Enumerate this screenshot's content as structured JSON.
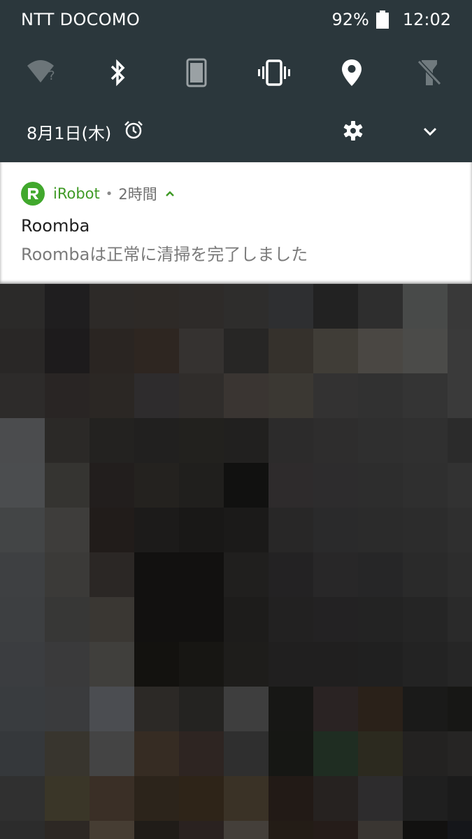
{
  "status_bar": {
    "carrier": "NTT DOCOMO",
    "battery": "92%",
    "time": "12:02"
  },
  "quick_settings": {
    "tiles": [
      "wifi-unknown",
      "bluetooth",
      "screen-rotation",
      "vibrate",
      "location",
      "flashlight-off"
    ],
    "date": "8月1日(木)"
  },
  "notification": {
    "app_name": "iRobot",
    "separator": "•",
    "time_ago": "2時間",
    "title": "Roomba",
    "body": "Roombaは正常に清掃を完了しました",
    "accent_color": "#3f9a26"
  },
  "colors": {
    "panel_bg": "#2b373c",
    "card_bg": "#ffffff"
  },
  "wallpaper_colors": [
    [
      "#2b2a29",
      "#1f1e1f",
      "#2d2a28",
      "#2e2a27",
      "#2e2b29",
      "#2e2d2c",
      "#2e2f31",
      "#222222",
      "#2e2e2e",
      "#484a49",
      "#393939"
    ],
    [
      "#292726",
      "#1d1b1c",
      "#2a2522",
      "#2e2621",
      "#353230",
      "#272625",
      "#35312c",
      "#403d37",
      "#4a4743",
      "#4b4b49",
      "#3a3a3a"
    ],
    [
      "#2d2b2a",
      "#292524",
      "#2b2724",
      "#2e2c2d",
      "#302d2b",
      "#3a3532",
      "#3b3833",
      "#333232",
      "#313131",
      "#343434",
      "#3a3a3a"
    ],
    [
      "#4b4c4e",
      "#2b2927",
      "#232220",
      "#21201f",
      "#22211e",
      "#21201f",
      "#2c2b2b",
      "#2e2d2d",
      "#2f2f2f",
      "#303030",
      "#2b2b2b"
    ],
    [
      "#4b4d4f",
      "#353431",
      "#221e1d",
      "#24221f",
      "#201f1d",
      "#111110",
      "#2e2b2c",
      "#2d2c2d",
      "#2d2d2d",
      "#2f2f2f",
      "#323232"
    ],
    [
      "#434546",
      "#3e3d3b",
      "#211c1a",
      "#1c1b1a",
      "#191817",
      "#1b1a19",
      "#282727",
      "#2a2a2b",
      "#2b2b2b",
      "#2c2c2c",
      "#2f2f2f"
    ],
    [
      "#3e4042",
      "#3b3a38",
      "#2b2725",
      "#121110",
      "#121110",
      "#201f1e",
      "#232223",
      "#282728",
      "#262627",
      "#2a2a2a",
      "#2d2d2d"
    ],
    [
      "#3d3f41",
      "#373736",
      "#3a3733",
      "#121110",
      "#121110",
      "#1d1c1b",
      "#222121",
      "#232223",
      "#232323",
      "#252525",
      "#2a2a2a"
    ],
    [
      "#3b3d40",
      "#3a3a3b",
      "#403f3c",
      "#13120f",
      "#171613",
      "#1e1d1b",
      "#201f1f",
      "#201f1f",
      "#202020",
      "#232323",
      "#262626"
    ],
    [
      "#393c3f",
      "#3a3b3d",
      "#4b4d51",
      "#2c2926",
      "#242321",
      "#3e3e3e",
      "#171715",
      "#2a2323",
      "#2a2119",
      "#1a1a19",
      "#171715"
    ],
    [
      "#35383b",
      "#38352e",
      "#444444",
      "#362c23",
      "#2e2522",
      "#2f2f2f",
      "#161714",
      "#1f2d22",
      "#2c2a1f",
      "#232221",
      "#262524"
    ],
    [
      "#303030",
      "#3a3628",
      "#3a2f26",
      "#2c241b",
      "#2e2418",
      "#3a3226",
      "#221a16",
      "#262220",
      "#2d2c2d",
      "#1f1f1f",
      "#1b1b1b"
    ],
    [
      "#2c2c2c",
      "#2d2824",
      "#463d33",
      "#201c18",
      "#2a2220",
      "#443f3a",
      "#231c16",
      "#251c19",
      "#3a3632",
      "#121110",
      "#15161a"
    ]
  ]
}
